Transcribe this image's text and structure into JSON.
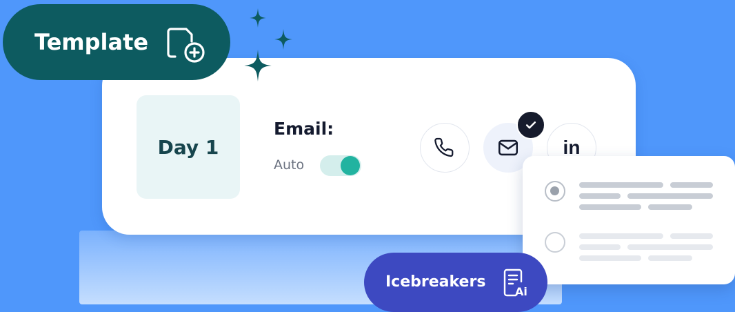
{
  "template": {
    "label": "Template",
    "icon": "document-add-icon"
  },
  "step": {
    "day_label": "Day 1",
    "channel_label": "Email:",
    "mode_label": "Auto",
    "auto_enabled": true
  },
  "channels": [
    {
      "name": "phone-icon",
      "selected": false
    },
    {
      "name": "envelope-icon",
      "selected": true
    },
    {
      "name": "linkedin-icon",
      "label": "in",
      "selected": false
    }
  ],
  "icebreakers": {
    "label": "Icebreakers",
    "icon": "document-ai-icon",
    "icon_text": "Ai"
  },
  "options": [
    {
      "selected": true
    },
    {
      "selected": false
    }
  ],
  "colors": {
    "background": "#4f97fb",
    "template_pill": "#0d5b60",
    "icebreakers_pill": "#3d49c1",
    "toggle_on": "#22b3a0",
    "sparkle": "#0d5b60"
  }
}
